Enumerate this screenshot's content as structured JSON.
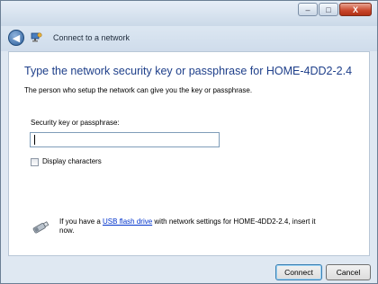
{
  "window": {
    "minimize_glyph": "–",
    "maximize_glyph": "□",
    "close_glyph": "X"
  },
  "nav": {
    "back_glyph": "◀",
    "title": "Connect to a network",
    "icon": "network-icon"
  },
  "main": {
    "heading": "Type the network security key or passphrase for HOME-4DD2-2.4",
    "description": "The person who setup the network can give you the key or passphrase.",
    "key_label": "Security key or passphrase:",
    "key_value": "",
    "display_characters_label": "Display characters",
    "display_characters_checked": false,
    "usb_text_before": "If you have a ",
    "usb_link": "USB flash drive",
    "usb_text_after": " with network settings for HOME-4DD2-2.4, insert it now.",
    "usb_icon": "usb-drive-icon"
  },
  "buttons": {
    "connect": "Connect",
    "cancel": "Cancel"
  },
  "colors": {
    "heading": "#1e3f8a",
    "link": "#0033cc",
    "frame": "#dfe8f2"
  }
}
